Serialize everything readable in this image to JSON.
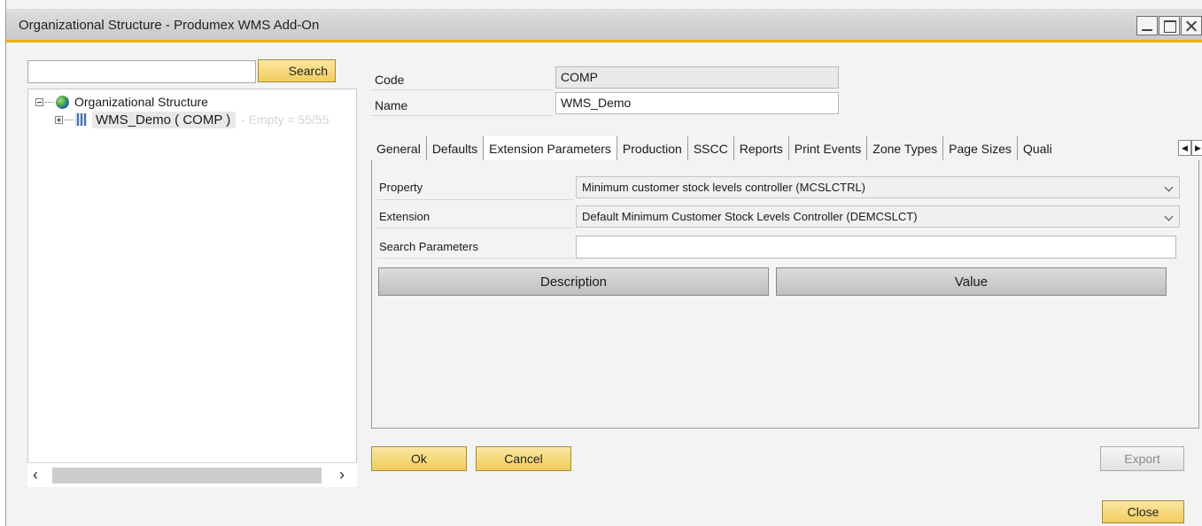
{
  "window": {
    "title": "Organizational Structure - Produmex WMS Add-On"
  },
  "left": {
    "search_value": "",
    "search_label": "Search",
    "tree": {
      "root_label": "Organizational Structure",
      "child_label": "WMS_Demo ( COMP )",
      "child_suffix": "- Empty = 55/55"
    }
  },
  "header": {
    "code_label": "Code",
    "code_value": "COMP",
    "name_label": "Name",
    "name_value": "WMS_Demo"
  },
  "tabs": [
    {
      "label": "General"
    },
    {
      "label": "Defaults"
    },
    {
      "label": "Extension Parameters",
      "active": true
    },
    {
      "label": "Production"
    },
    {
      "label": "SSCC"
    },
    {
      "label": "Reports"
    },
    {
      "label": "Print Events"
    },
    {
      "label": "Zone Types"
    },
    {
      "label": "Page Sizes"
    },
    {
      "label": "Quali"
    }
  ],
  "panel": {
    "property_label": "Property",
    "property_value": "Minimum customer stock levels controller (MCSLCTRL)",
    "extension_label": "Extension",
    "extension_value": "Default Minimum Customer Stock Levels Controller (DEMCSLCT)",
    "search_params_label": "Search Parameters",
    "search_params_value": "",
    "columns": [
      "Description",
      "Value"
    ]
  },
  "footer": {
    "ok_label": "Ok",
    "cancel_label": "Cancel",
    "export_label": "Export",
    "close_label": "Close"
  },
  "colors": {
    "accent": "#f0b000",
    "button_yellow": "#f2cc5c"
  }
}
